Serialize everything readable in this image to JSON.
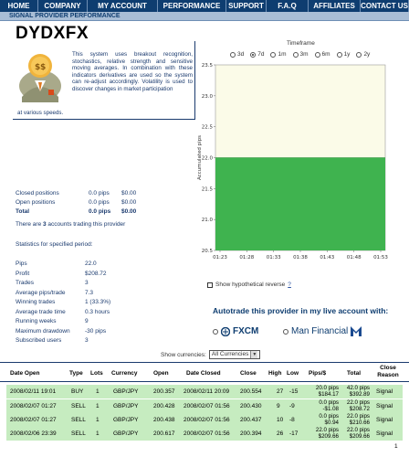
{
  "nav": [
    "HOME",
    "COMPANY",
    "MY ACCOUNT",
    "PERFORMANCE",
    "SUPPORT",
    "F.A.Q",
    "AFFILIATES",
    "CONTACT US"
  ],
  "subheader": "SIGNAL PROVIDER PERFORMANCE",
  "provider": {
    "name": "DYDXFX",
    "description": "This system uses breakout recognition, stochastics, relative strength and sensitive moving averages. In combination with these indicators derivatives are used so the system can re-adjust accordingly. Volatility is used to discover changes in market participation",
    "description_end": "at various speeds."
  },
  "positions": {
    "closed_label": "Closed positions",
    "closed_pips": "0.0 pips",
    "closed_usd": "$0.00",
    "open_label": "Open positions",
    "open_pips": "0.0 pips",
    "open_usd": "$0.00",
    "total_label": "Total",
    "total_pips": "0.0 pips",
    "total_usd": "$0.00"
  },
  "accounts": {
    "pre": "There are ",
    "count": "3",
    "post": " accounts trading this provider"
  },
  "stats_title": "Statistics for specified period:",
  "stats": [
    {
      "label": "Pips",
      "value": "22.0"
    },
    {
      "label": "Profit",
      "value": "$208.72"
    },
    {
      "label": "Trades",
      "value": "3"
    },
    {
      "label": "Average pips/trade",
      "value": "7.3"
    },
    {
      "label": "Winning trades",
      "value": "1 (33.3%)"
    },
    {
      "label": "Average trade time",
      "value": "0.3 hours"
    },
    {
      "label": "Running weeks",
      "value": "9"
    },
    {
      "label": "Maximum drawdown",
      "value": "-30 pips"
    },
    {
      "label": "Subscribed users",
      "value": "3"
    }
  ],
  "timeframe": {
    "label": "Timeframe",
    "options": [
      "3d",
      "7d",
      "1m",
      "3m",
      "6m",
      "1y",
      "2y"
    ],
    "selected": "7d"
  },
  "chart_data": {
    "type": "area",
    "ylabel": "Accumulated pips",
    "xlabel": "",
    "ylim": [
      20.5,
      23.5
    ],
    "yticks": [
      "23.5",
      "23.0",
      "22.5",
      "22.0",
      "21.5",
      "21.0",
      "20.5"
    ],
    "xticks": [
      "01:23",
      "01:28",
      "01:33",
      "01:38",
      "01:43",
      "01:48",
      "01:53"
    ],
    "x": [
      "01:23",
      "01:53"
    ],
    "values": [
      22.0,
      22.0
    ],
    "colors": {
      "area": "#3fb34f",
      "background": "#fbfbe8"
    }
  },
  "hypothetical": {
    "label": "Show hypothetical reverse",
    "link": "?"
  },
  "autotrade": {
    "text": "Autotrade this provider in my live account with:",
    "broker1": "FXCM",
    "broker2": "Man Financial"
  },
  "currencies": {
    "label": "Show currencies:",
    "selected": "All Currencies"
  },
  "table": {
    "headers": [
      "Date Open",
      "Type",
      "Lots",
      "Currency",
      "Open",
      "Date Closed",
      "Close",
      "High",
      "Low",
      "Pips/$",
      "Total",
      "Close Reason"
    ],
    "rows": [
      {
        "date_open": "2008/02/11 19:01",
        "type": "BUY",
        "lots": "1",
        "currency": "GBP/JPY",
        "open": "200.357",
        "date_closed": "2008/02/11 20:09",
        "close": "200.554",
        "high": "27",
        "low": "-15",
        "pips": "20.0 pips",
        "usd": "$184.17",
        "total_pips": "42.0 pips",
        "total_usd": "$392.89",
        "reason": "Signal"
      },
      {
        "date_open": "2008/02/07 01:27",
        "type": "SELL",
        "lots": "1",
        "currency": "GBP/JPY",
        "open": "200.428",
        "date_closed": "2008/02/07 01:56",
        "close": "200.430",
        "high": "9",
        "low": "-9",
        "pips": "0.0 pips",
        "usd": "-$1.08",
        "total_pips": "22.0 pips",
        "total_usd": "$208.72",
        "reason": "Signal"
      },
      {
        "date_open": "2008/02/07 01:27",
        "type": "SELL",
        "lots": "1",
        "currency": "GBP/JPY",
        "open": "200.438",
        "date_closed": "2008/02/07 01:56",
        "close": "200.437",
        "high": "10",
        "low": "-8",
        "pips": "0.0 pips",
        "usd": "$0.94",
        "total_pips": "22.0 pips",
        "total_usd": "$210.66",
        "reason": "Signal"
      },
      {
        "date_open": "2008/02/06 23:39",
        "type": "SELL",
        "lots": "1",
        "currency": "GBP/JPY",
        "open": "200.617",
        "date_closed": "2008/02/07 01:56",
        "close": "200.394",
        "high": "26",
        "low": "-17",
        "pips": "22.0 pips",
        "usd": "$209.66",
        "total_pips": "22.0 pips",
        "total_usd": "$209.66",
        "reason": "Signal"
      }
    ]
  },
  "page_number": "1"
}
